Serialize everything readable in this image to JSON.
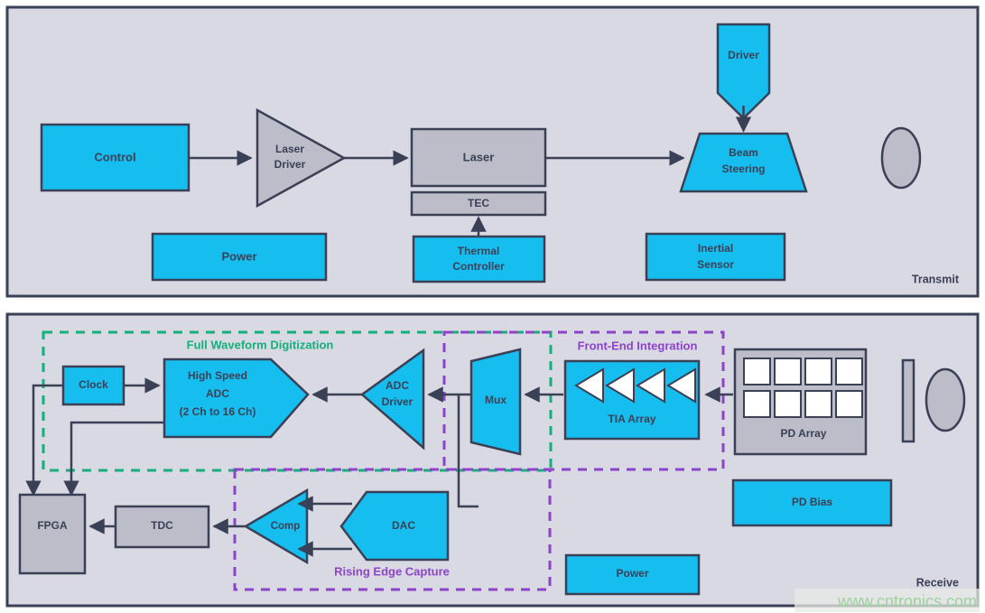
{
  "colors": {
    "panel_fill": "#d8d9e3",
    "panel_stroke": "#3a4055",
    "cyan": "#16bef0",
    "gray_block": "#bcbdc9",
    "stroke": "#3a4055",
    "green_dash": "#13b07c",
    "purple_dash": "#8e44c8",
    "white": "#ffffff",
    "watermark": "#9fd0a0"
  },
  "transmit": {
    "panel_label": "Transmit",
    "blocks": {
      "control": "Control",
      "laser_driver_line1": "Laser",
      "laser_driver_line2": "Driver",
      "laser": "Laser",
      "tec": "TEC",
      "thermal_line1": "Thermal",
      "thermal_line2": "Controller",
      "power": "Power",
      "driver": "Driver",
      "beam_steering_line1": "Beam",
      "beam_steering_line2": "Steering",
      "inertial_line1": "Inertial",
      "inertial_line2": "Sensor"
    }
  },
  "receive": {
    "panel_label": "Receive",
    "groups": {
      "full_waveform": "Full Waveform Digitization",
      "front_end": "Front-End Integration",
      "rising_edge": "Rising Edge Capture"
    },
    "blocks": {
      "clock": "Clock",
      "adc_line1": "High Speed",
      "adc_line2": "ADC",
      "adc_line3": "(2 Ch to 16 Ch)",
      "adc_driver_line1": "ADC",
      "adc_driver_line2": "Driver",
      "mux": "Mux",
      "tia_array": "TIA Array",
      "pd_array": "PD Array",
      "pd_bias": "PD Bias",
      "power": "Power",
      "fpga": "FPGA",
      "tdc": "TDC",
      "comp": "Comp",
      "dac": "DAC"
    }
  },
  "watermark": "www.cntronics.com"
}
